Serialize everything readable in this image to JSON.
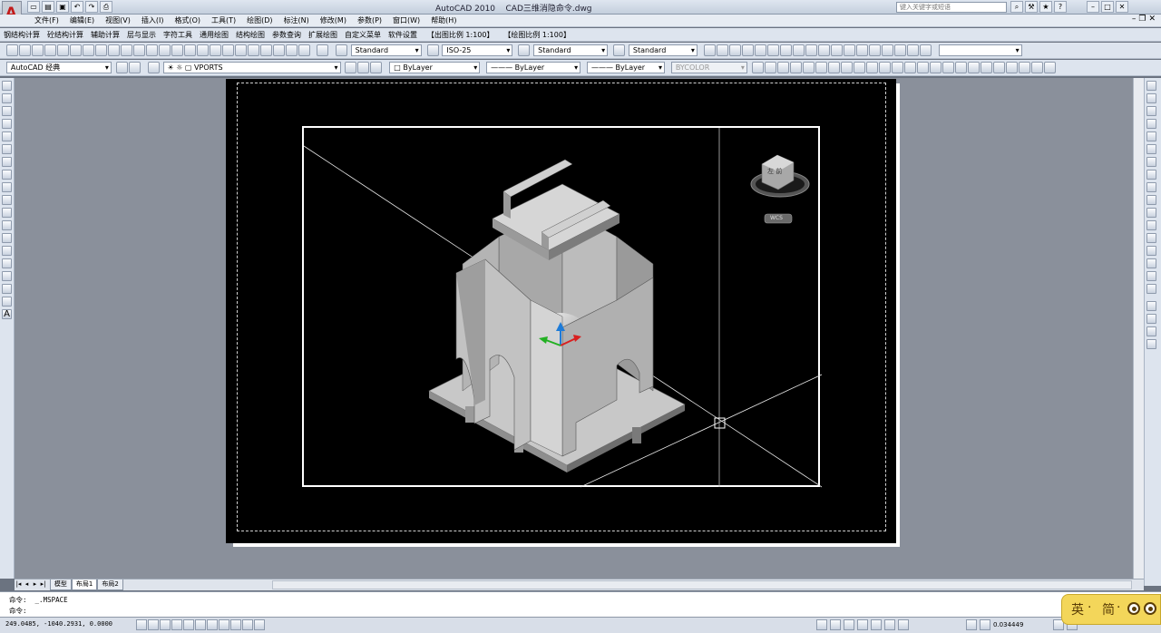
{
  "app": {
    "title": "AutoCAD 2010",
    "filename": "CAD三维消隐命令.dwg",
    "help_placeholder": "键入关键字或短语",
    "logo_letter": "A"
  },
  "menubar": {
    "items": [
      "文件(F)",
      "编辑(E)",
      "视图(V)",
      "插入(I)",
      "格式(O)",
      "工具(T)",
      "绘图(D)",
      "标注(N)",
      "修改(M)",
      "参数(P)",
      "窗口(W)",
      "帮助(H)"
    ]
  },
  "toolbar1": {
    "items": [
      "钢结构计算",
      "砼结构计算",
      "辅助计算",
      "层与显示",
      "字符工具",
      "通用绘图",
      "结构绘图",
      "参数查询",
      "扩展绘图",
      "自定义菜单",
      "软件设置"
    ],
    "scale_out": "【出图比例 1:100】",
    "scale_draw": "【绘图比例 1:100】"
  },
  "toolbar2": {
    "text_style": "Standard",
    "dim_style": "ISO-25",
    "table_style": "Standard",
    "mleader_style": "Standard"
  },
  "toolbar3": {
    "workspace": "AutoCAD 经典",
    "layer": "VPORTS",
    "color": "ByLayer",
    "linetype": "ByLayer",
    "lineweight": "ByLayer",
    "plotstyle": "BYCOLOR"
  },
  "viewcube": {
    "face_label": "左 前",
    "wcs_label": "WCS"
  },
  "tabs": {
    "items": [
      "模型",
      "布局1",
      "布局2"
    ],
    "active_index": 1
  },
  "command": {
    "line1_prompt": "命令:",
    "line1_text": "_.MSPACE",
    "line2_prompt": "命令:"
  },
  "status": {
    "coords": "249.0485, -1040.2931, 0.0000",
    "zoom": "0.034449"
  },
  "ime": {
    "lang": "英",
    "mode": "简"
  },
  "colors": {
    "paper": "#000000",
    "workspace": "#8a909b",
    "model_gray": "#b8b8b8",
    "accent_red": "#c01818"
  }
}
